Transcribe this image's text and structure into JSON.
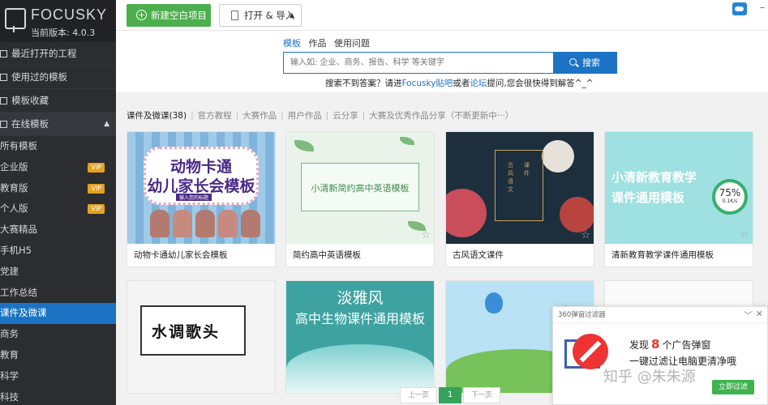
{
  "brand": {
    "name": "FOCUSKY",
    "version": "当前版本: 4.0.3"
  },
  "sidebar": {
    "items": [
      {
        "label": "最近打开的工程"
      },
      {
        "label": "使用过的模板"
      },
      {
        "label": "模板收藏"
      },
      {
        "label": "在线模板"
      }
    ],
    "online_expand_icon": "caret-up-icon",
    "sub_items": [
      {
        "label": "所有模板",
        "vip": ""
      },
      {
        "label": "企业版",
        "vip": "VIP"
      },
      {
        "label": "教育版",
        "vip": "VIP"
      },
      {
        "label": "个人版",
        "vip": "VIP"
      },
      {
        "label": "大赛精品",
        "vip": ""
      },
      {
        "label": "手机H5",
        "vip": ""
      },
      {
        "label": "党建",
        "vip": ""
      },
      {
        "label": "工作总结",
        "vip": ""
      },
      {
        "label": "课件及微课",
        "vip": ""
      },
      {
        "label": "商务",
        "vip": ""
      },
      {
        "label": "教育",
        "vip": ""
      },
      {
        "label": "科学",
        "vip": ""
      },
      {
        "label": "科技",
        "vip": ""
      }
    ],
    "active_sub_index": 8
  },
  "toolbar": {
    "new_label": "新建空白项目",
    "open_label": "打开 & 导入"
  },
  "search": {
    "tabs": [
      "模板",
      "作品",
      "使用问题"
    ],
    "active_tab": 0,
    "placeholder": "输入如: 企业、商务、报告、科学 等关键字",
    "button_label": "搜索",
    "hint_pre": "搜索不到答案？请进",
    "hint_link1": "Focusky贴吧",
    "hint_mid": "或者",
    "hint_link2": "论坛",
    "hint_post": "提问,您会很快得到解答^_^"
  },
  "filters": {
    "current": "课件及微课(38)",
    "items": [
      "官方教程",
      "大赛作品",
      "用户作品",
      "云分享",
      "大赛及优秀作品分享（不断更新中···）"
    ]
  },
  "cards": [
    {
      "title": "动物卡通幼儿家长会模板",
      "thumb_line1": "动物卡通",
      "thumb_line2": "幼儿家长会模板",
      "thumb_tag": "输入您的标题"
    },
    {
      "title": "简约高中英语模板",
      "thumb_line1": "小清新简约高中英语模板"
    },
    {
      "title": "古风语文课件",
      "thumb_line1": "古风语文",
      "thumb_line2": "课件"
    },
    {
      "title": "清新教育教学课件通用模板",
      "thumb_line1": "小清新教育教学",
      "thumb_line2": "课件通用模板",
      "thumb_ring_pct": "75%",
      "thumb_ring_speed": "0.1K/s"
    },
    {
      "title": "",
      "thumb_line1": "水调歌头"
    },
    {
      "title": "",
      "thumb_line1": "淡雅风",
      "thumb_line2": "高中生物课件通用模板"
    },
    {
      "title": "",
      "thumb_line1": ""
    },
    {
      "title": "",
      "thumb_line1": ""
    }
  ],
  "pager": {
    "prev": "上一页",
    "current": "1",
    "next": "下一页"
  },
  "popup": {
    "title": "360弹窗过滤器",
    "line1_pre": "发现",
    "count": "8",
    "line1_post": "个广告弹窗",
    "line2": "一键过滤让电脑更清净哦",
    "action": "立即过滤",
    "watermark": "知乎 @朱朱源"
  },
  "colors": {
    "sidebar_bg": "#2b2d31",
    "accent_blue": "#1c73c4",
    "green": "#4cae4c",
    "vip": "#e5a21c"
  }
}
